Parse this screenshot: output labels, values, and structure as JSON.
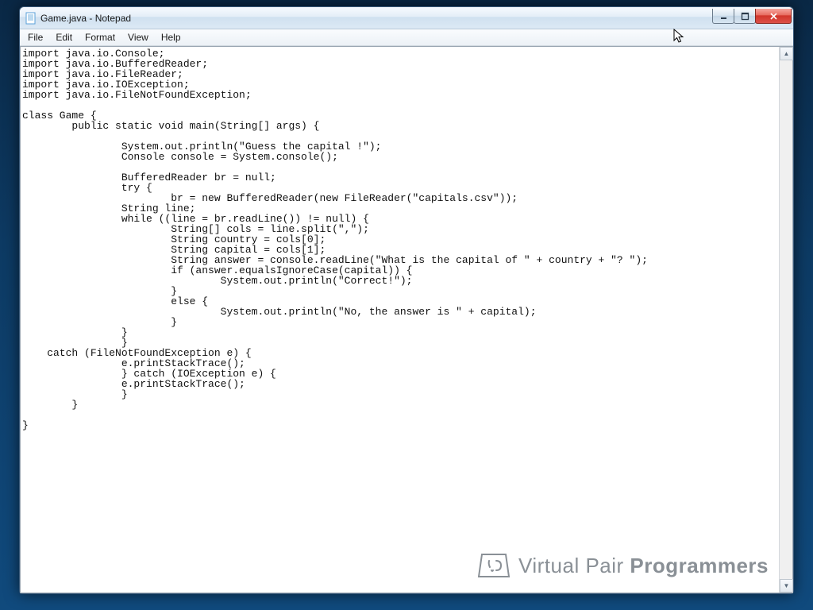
{
  "window": {
    "title": "Game.java - Notepad"
  },
  "menubar": {
    "items": [
      "File",
      "Edit",
      "Format",
      "View",
      "Help"
    ]
  },
  "watermark": {
    "text_light": "Virtual Pair ",
    "text_bold": "Programmers"
  },
  "editor": {
    "content": "import java.io.Console;\nimport java.io.BufferedReader;\nimport java.io.FileReader;\nimport java.io.IOException;\nimport java.io.FileNotFoundException;\n\nclass Game {\n        public static void main(String[] args) {\n\n                System.out.println(\"Guess the capital !\");\n                Console console = System.console();\n\n                BufferedReader br = null;\n                try {\n                        br = new BufferedReader(new FileReader(\"capitals.csv\"));\n                String line;\n                while ((line = br.readLine()) != null) {\n                        String[] cols = line.split(\",\");\n                        String country = cols[0];\n                        String capital = cols[1];\n                        String answer = console.readLine(\"What is the capital of \" + country + \"? \");\n                        if (answer.equalsIgnoreCase(capital)) {\n                                System.out.println(\"Correct!\");\n                        }\n                        else {\n                                System.out.println(\"No, the answer is \" + capital);\n                        }\n                }\n                }\n    catch (FileNotFoundException e) {\n                e.printStackTrace();\n                } catch (IOException e) {\n                e.printStackTrace();\n                }\n        }\n\n}"
  }
}
